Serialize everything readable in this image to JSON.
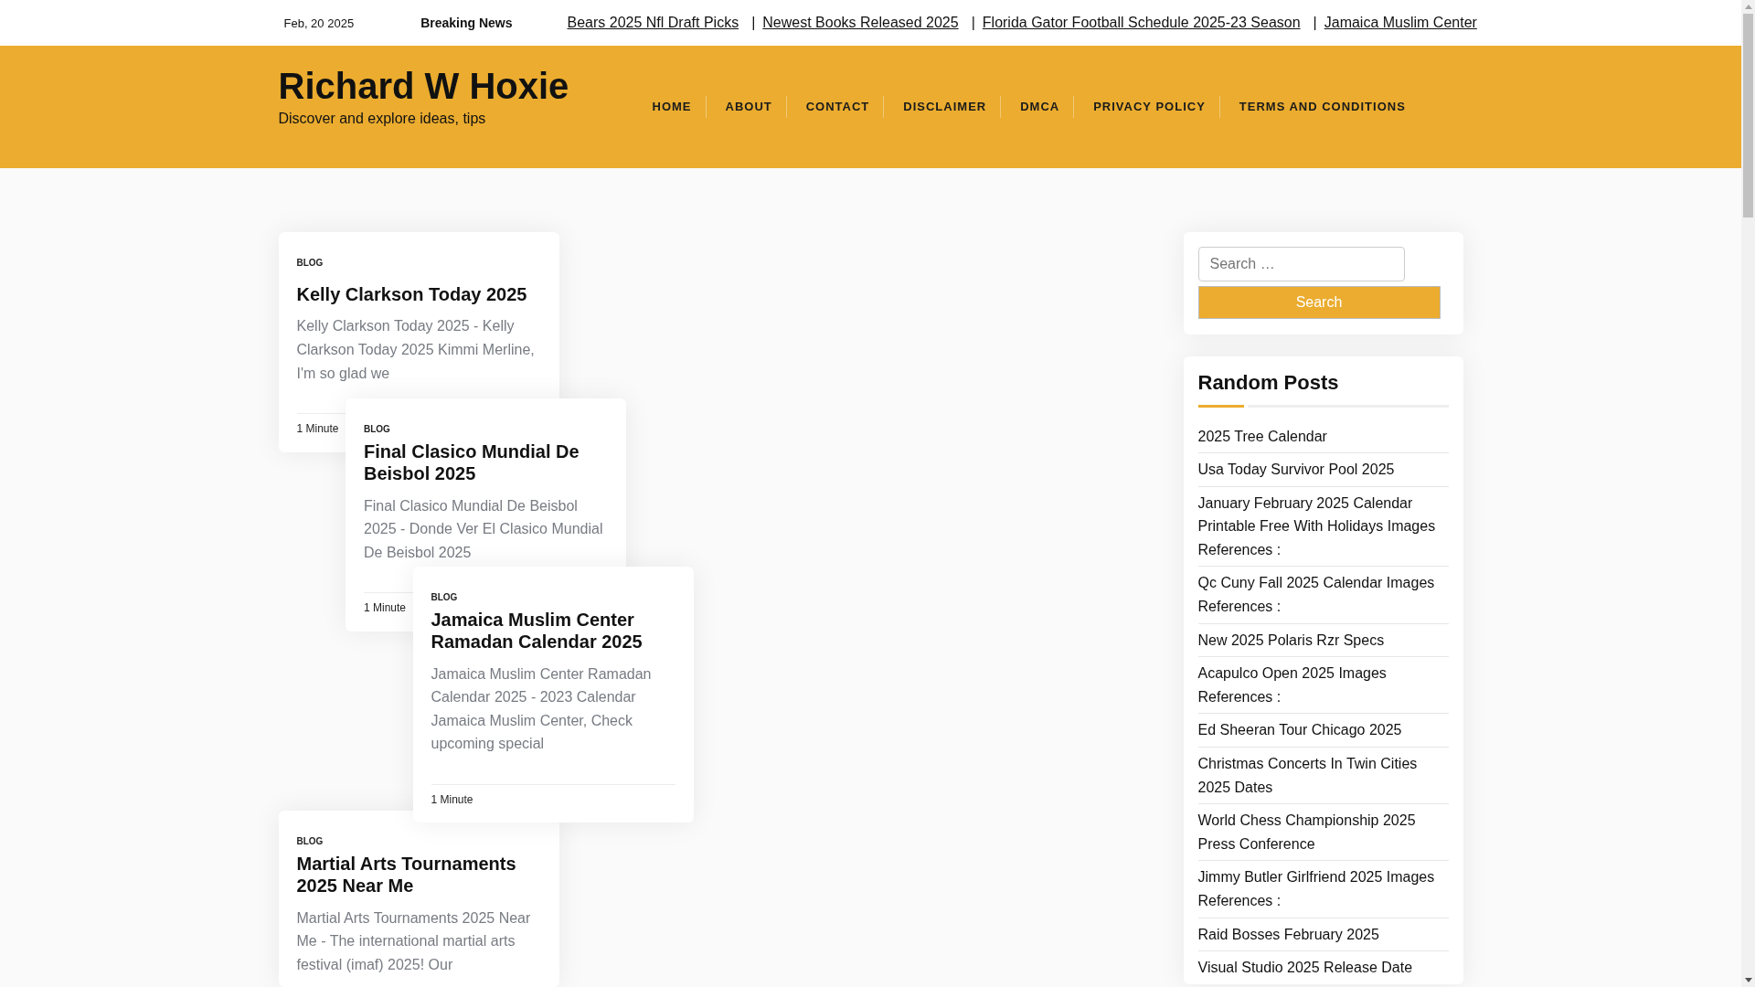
{
  "top_bar": {
    "date": "Feb, 20 2025",
    "breaking_label": "Breaking News",
    "ticker": [
      {
        "title": "Bears 2025 Nfl Draft Picks"
      },
      {
        "separator": "|",
        "title": "Newest Books Released 2025"
      },
      {
        "separator": "|",
        "title": "Florida Gator Football Schedule 2025-23 Season"
      },
      {
        "separator": "|",
        "title": "Jamaica Muslim Center"
      }
    ]
  },
  "header": {
    "site_title": "Richard W Hoxie",
    "tagline": "Discover and explore ideas, tips",
    "nav": [
      "HOME",
      "ABOUT",
      "CONTACT",
      "DISCLAIMER",
      "DMCA",
      "PRIVACY POLICY",
      "TERMS AND CONDITIONS"
    ]
  },
  "posts": [
    {
      "category": "BLOG",
      "title": "Kelly Clarkson Today 2025",
      "excerpt": "Kelly Clarkson Today 2025 - Kelly Clarkson Today 2025 Kimmi Merline, I'm so glad we",
      "read_time": "1 Minute"
    },
    {
      "category": "BLOG",
      "title": "Final Clasico Mundial De Beisbol 2025",
      "excerpt": "Final Clasico Mundial De Beisbol 2025 - Donde Ver El Clasico Mundial De Beisbol 2025",
      "read_time": "1 Minute"
    },
    {
      "category": "BLOG",
      "title": "Jamaica Muslim Center Ramadan Calendar 2025",
      "excerpt": "Jamaica Muslim Center Ramadan Calendar 2025 - 2023 Calendar Jamaica Muslim Center, Check upcoming special",
      "read_time": "1 Minute"
    },
    {
      "category": "BLOG",
      "title": "Martial Arts Tournaments 2025 Near Me",
      "excerpt": "Martial Arts Tournaments 2025 Near Me - The international martial arts festival (imaf) 2025! Our"
    }
  ],
  "sidebar": {
    "search": {
      "placeholder": "Search …",
      "button": "Search"
    },
    "random_posts": {
      "title": "Random Posts",
      "items": [
        "2025 Tree Calendar",
        "Usa Today Survivor Pool 2025",
        "January February 2025 Calendar Printable Free With Holidays Images References :",
        "Qc Cuny Fall 2025 Calendar Images References :",
        "New 2025 Polaris Rzr Specs",
        "Acapulco Open 2025 Images References :",
        "Ed Sheeran Tour Chicago 2025",
        "Christmas Concerts In Twin Cities 2025 Dates",
        "World Chess Championship 2025 Press Conference",
        "Jimmy Butler Girlfriend 2025 Images References :",
        "Raid Bosses February 2025",
        "Visual Studio 2025 Release Date"
      ]
    }
  }
}
